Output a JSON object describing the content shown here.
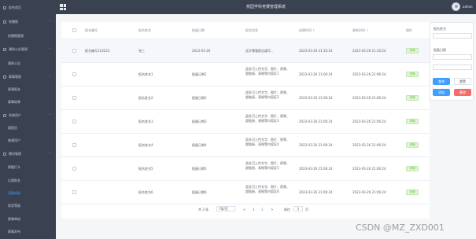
{
  "header": {
    "title": "校园学科竞赛管理系统",
    "user": "admin"
  },
  "sidebar": {
    "items": [
      {
        "label": "综合首页",
        "type": "top"
      },
      {
        "label": "轮播图",
        "type": "group"
      },
      {
        "label": "轮播图管理",
        "type": "sub"
      },
      {
        "label": "通知公告管理",
        "type": "group"
      },
      {
        "label": "通知公告",
        "type": "sub"
      },
      {
        "label": "赛事管理",
        "type": "group"
      },
      {
        "label": "赛事报名",
        "type": "sub"
      },
      {
        "label": "赛事结果",
        "type": "sub"
      },
      {
        "label": "系统用户",
        "type": "group"
      },
      {
        "label": "管理员",
        "type": "sub"
      },
      {
        "label": "普通用户",
        "type": "sub"
      },
      {
        "label": "模块管理",
        "type": "group"
      },
      {
        "label": "赛题打卡",
        "type": "sub"
      },
      {
        "label": "比赛报名",
        "type": "sub"
      },
      {
        "label": "竞赛成绩",
        "type": "sub",
        "active": true
      },
      {
        "label": "获奖等级",
        "type": "sub"
      },
      {
        "label": "赛事审核",
        "type": "sub"
      },
      {
        "label": "赛事发布",
        "type": "sub"
      }
    ]
  },
  "table": {
    "columns": [
      "报名编号",
      "报名姓名",
      "报备日期",
      "报名信息",
      "创建时间",
      "更新时间",
      "操作"
    ],
    "rows": [
      {
        "id": "报名编号110233",
        "name": "张三",
        "date": "2023-03-26",
        "info": "这步骤看报告填写...",
        "created": "2023-03-26 21:10:24",
        "updated": "2023-03-26 21:10:24",
        "action": "详情",
        "hover": true
      },
      {
        "id": "",
        "name": "报名姓名1",
        "date": "报备日期1",
        "info": "此处可上传文字、图片、视频、超链接、表格等内容区1",
        "created": "2023-03-26 21:06:24",
        "updated": "2023-03-26 21:06:24",
        "action": "详情"
      },
      {
        "id": "",
        "name": "报名姓名2",
        "date": "报备日期2",
        "info": "此处可上传文字、图片、视频、超链接、表格等内容区2",
        "created": "2023-03-26 21:06:24",
        "updated": "2023-03-26 21:06:24",
        "action": "详情"
      },
      {
        "id": "",
        "name": "报名姓名3",
        "date": "报备日期3",
        "info": "此处可上传文字、图片、视频、超链接、表格等内容区3",
        "created": "2023-03-26 21:06:24",
        "updated": "2023-03-26 21:06:24",
        "action": "详情"
      },
      {
        "id": "",
        "name": "报名姓名4",
        "date": "报备日期4",
        "info": "此处可上传文字、图片、视频、超链接、表格等内容区4",
        "created": "2023-03-26 21:06:24",
        "updated": "2023-03-26 21:06:24",
        "action": "详情"
      },
      {
        "id": "",
        "name": "报名姓名5",
        "date": "报备日期5",
        "info": "此处可上传文字、图片、视频、超链接、表格等内容区5",
        "created": "2023-03-26 21:06:24",
        "updated": "2023-03-26 21:06:24",
        "action": "详情"
      },
      {
        "id": "",
        "name": "报名姓名6",
        "date": "报备日期6",
        "info": "此处可上传文字、图片、视频、超链接、表格等内容区6",
        "created": "2023-03-26 21:06:24",
        "updated": "2023-03-26 21:06:24",
        "action": "详情"
      }
    ]
  },
  "pagination": {
    "total": "共 3 条",
    "page_size": "7条/页",
    "prev": "<",
    "page_1": "1",
    "page_2": "2",
    "next": ">",
    "goto_label": "前往",
    "goto_value": "1",
    "goto_unit": "页"
  },
  "filter": {
    "name_label": "报名姓名",
    "date_label": "报备日期",
    "search": "查询",
    "reset": "重置",
    "add": "添加",
    "delete": "删除"
  },
  "watermark": "CSDN @MZ_ZXD001",
  "colors": {
    "sidebar_bg": "#3a4150",
    "primary": "#409eff",
    "danger": "#f56c6c",
    "success": "#67c23a"
  }
}
